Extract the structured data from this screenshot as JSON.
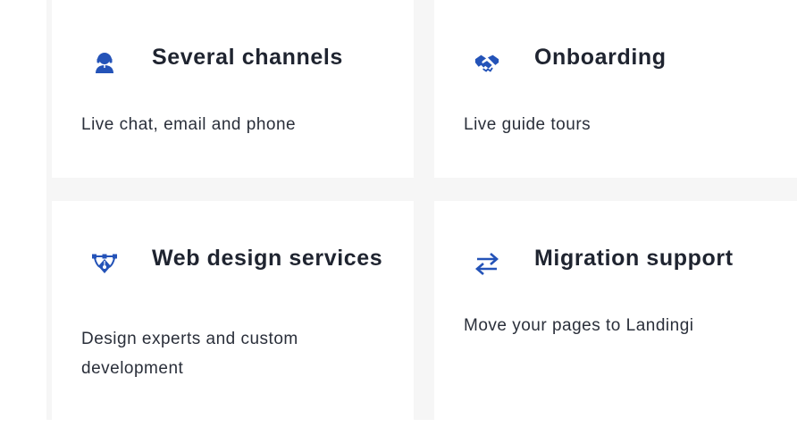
{
  "accent_color": "#2453b8",
  "features": [
    {
      "icon": "headset-user-icon",
      "title": "Several channels",
      "description": "Live chat, email and phone"
    },
    {
      "icon": "handshake-icon",
      "title": "Onboarding",
      "description": "Live guide tours"
    },
    {
      "icon": "design-pen-tool-icon",
      "title": "Web design services",
      "description": "Design experts and custom development"
    },
    {
      "icon": "swap-arrows-icon",
      "title": "Migration support",
      "description": "Move your pages to Landingi"
    }
  ]
}
